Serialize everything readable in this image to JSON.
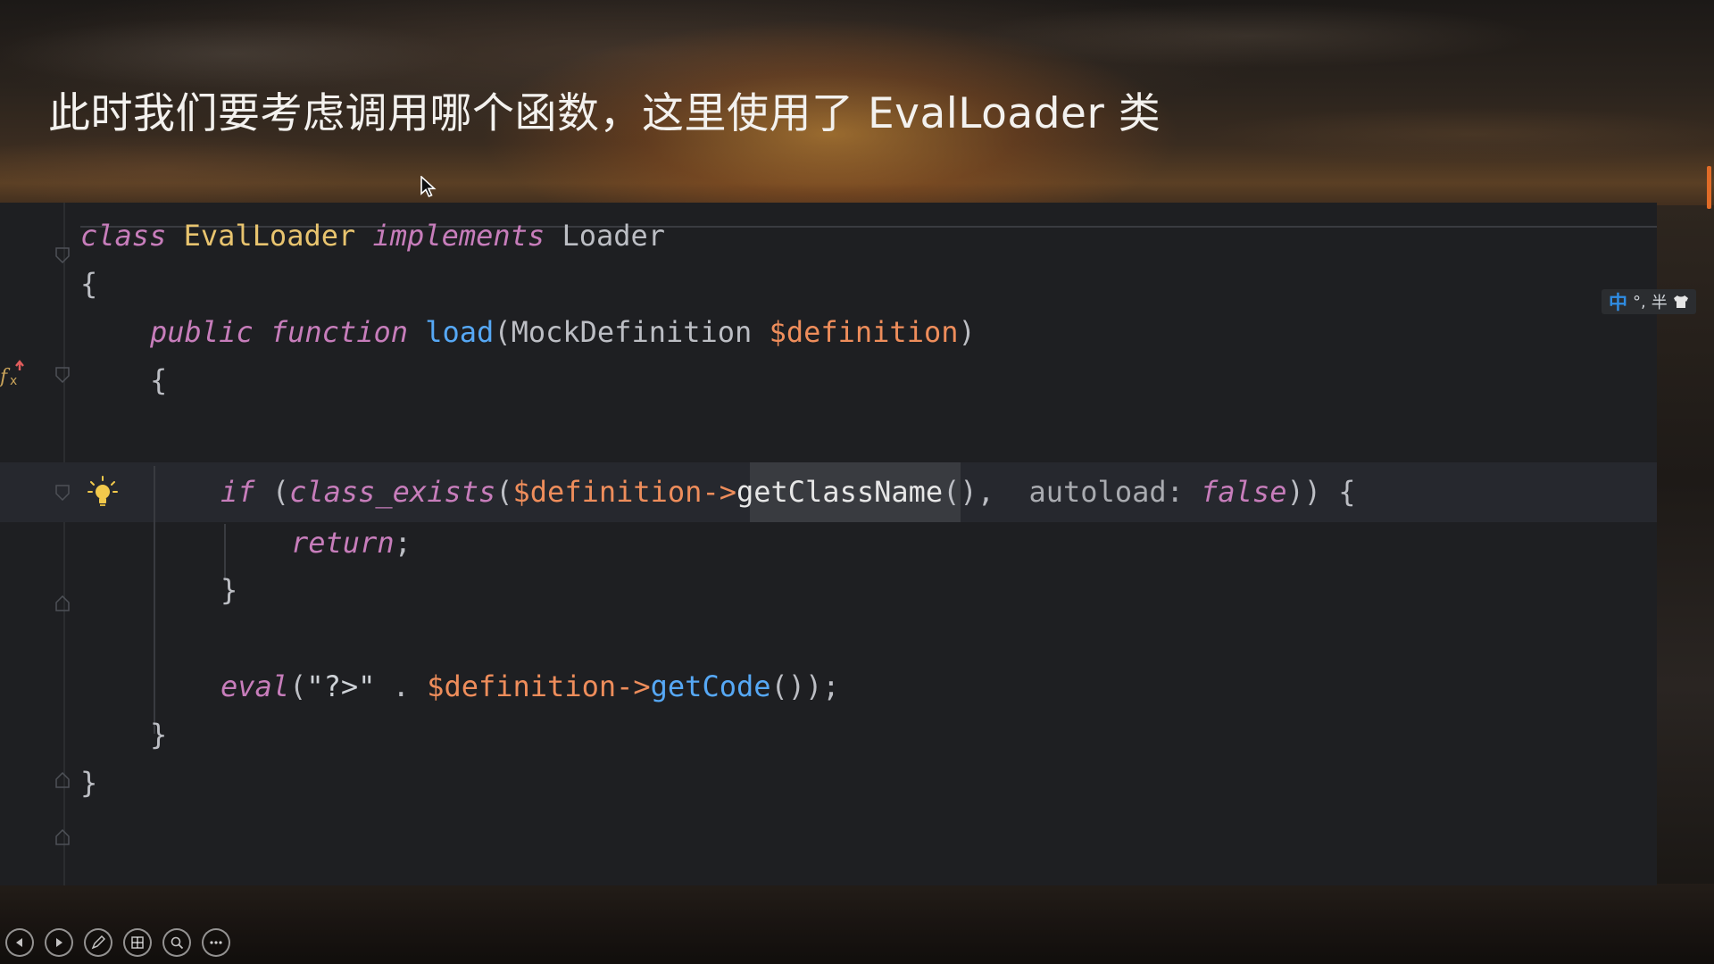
{
  "slide": {
    "title": "此时我们要考虑调用哪个函数，这里使用了 EvalLoader 类"
  },
  "ime": {
    "lang": "中",
    "punct": "°,",
    "width": "半"
  },
  "code": {
    "line1": {
      "kw": "class",
      "name": "EvalLoader",
      "kw2": "implements",
      "iface": "Loader"
    },
    "line2": "{",
    "line3": {
      "kw": "public",
      "kw2": "function",
      "fn": "load",
      "open": "(",
      "type": "MockDefinition",
      "var": "$definition",
      "close": ")"
    },
    "line4": "{",
    "line5": {
      "kw": "if",
      "p1": " (",
      "fn": "class_exists",
      "p2": "(",
      "var": "$definition->",
      "method": "getClassName",
      "p3": "(),",
      "hint": "autoload:",
      "kw2": "false",
      "p4": ")) {"
    },
    "line6": {
      "kw": "return",
      "semi": ";"
    },
    "line7": "}",
    "line8": {
      "kw": "eval",
      "p1": "(",
      "str": "\"?>\"",
      "dot": " . ",
      "var": "$definition->",
      "method": "getCode",
      "p2": "());"
    },
    "line9": "}",
    "line10": "}"
  },
  "colors": {
    "editor_bg": "#1e1f22",
    "keyword": "#c77dbb",
    "function": "#56a8f5",
    "variable": "#ee8d5b",
    "text": "#bcbec4"
  },
  "icons": [
    "fx-gutter-icon",
    "lightbulb-icon",
    "fold-icon",
    "cursor-icon",
    "prev-icon",
    "next-icon",
    "pen-icon",
    "slides-icon",
    "zoom-icon",
    "more-icon"
  ]
}
